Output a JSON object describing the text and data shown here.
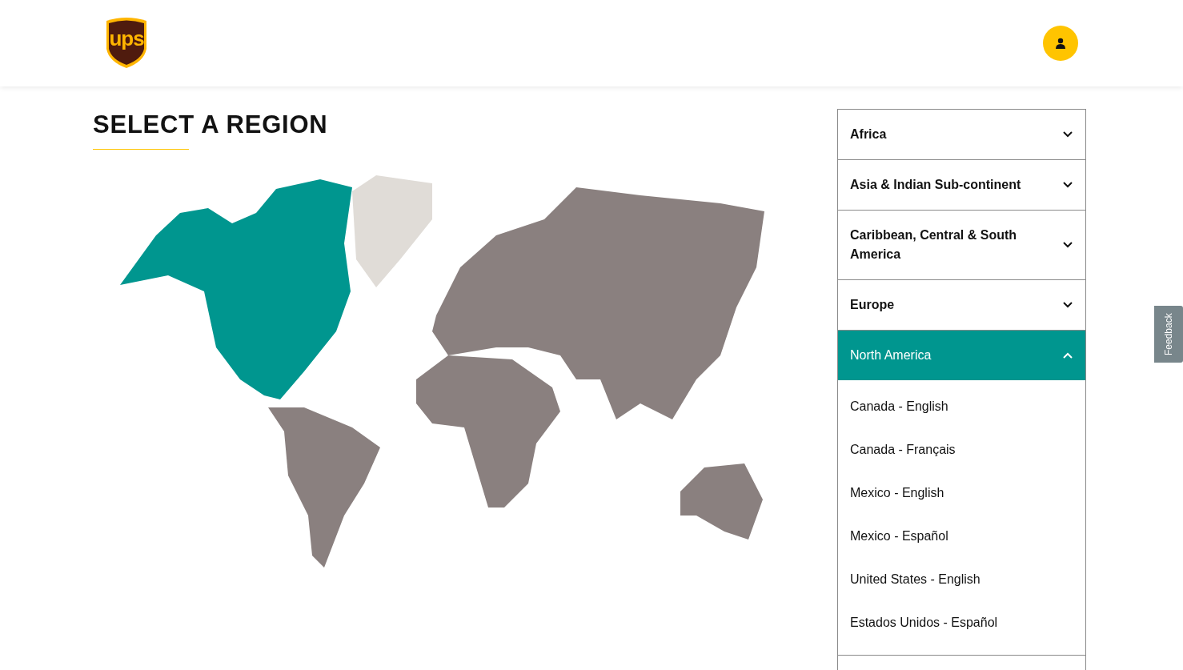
{
  "header": {
    "logo": "ups"
  },
  "title": "SELECT A REGION",
  "regions": [
    {
      "name": "Africa",
      "expanded": false
    },
    {
      "name": "Asia & Indian Sub-continent",
      "expanded": false
    },
    {
      "name": "Caribbean, Central & South America",
      "expanded": false
    },
    {
      "name": "Europe",
      "expanded": false
    },
    {
      "name": "North America",
      "expanded": true,
      "countries": [
        "Canada - English",
        "Canada - Français",
        "Mexico - English",
        "Mexico - Español",
        "United States - English",
        "Estados Unidos - Español"
      ]
    }
  ],
  "feedback_tab": "Feedback"
}
